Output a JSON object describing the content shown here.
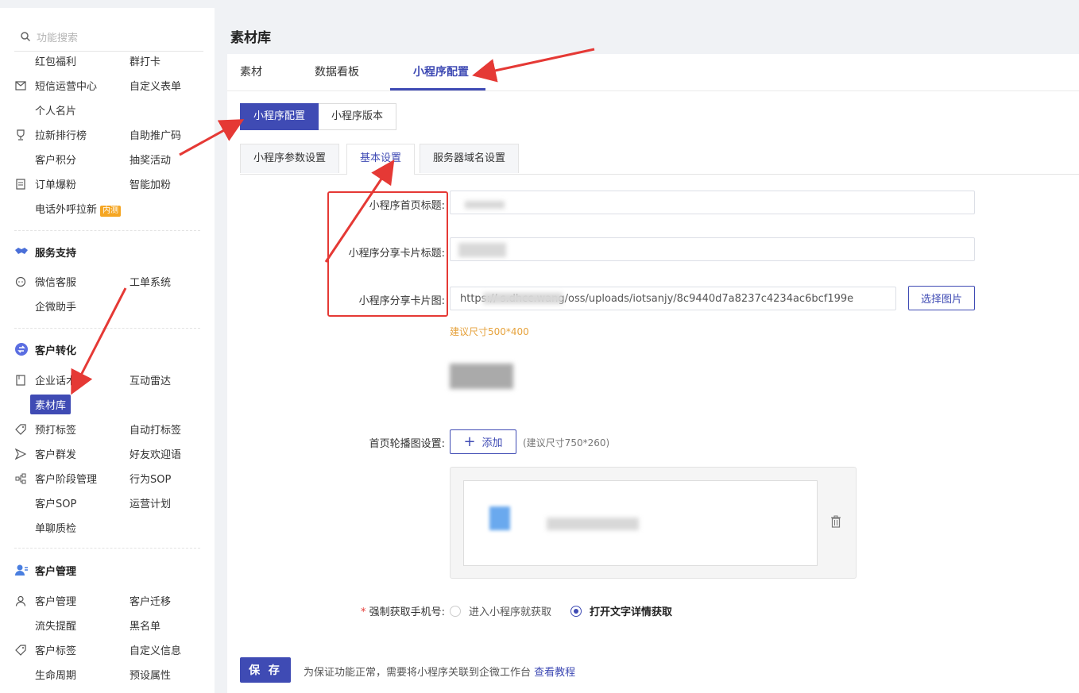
{
  "sidebar": {
    "search_placeholder": "功能搜索",
    "rows": [
      {
        "c1": "红包福利",
        "c2": "群打卡",
        "icon": ""
      },
      {
        "c1": "短信运营中心",
        "c2": "自定义表单",
        "icon": "mail-icon"
      },
      {
        "c1": "个人名片",
        "c2": "",
        "icon": ""
      },
      {
        "c1": "拉新排行榜",
        "c2": "自助推广码",
        "icon": "trophy-icon"
      },
      {
        "c1": "客户积分",
        "c2": "抽奖活动",
        "icon": ""
      },
      {
        "c1": "订单爆粉",
        "c2": "智能加粉",
        "icon": "order-icon"
      },
      {
        "c1": "电话外呼拉新",
        "c2": "",
        "icon": "",
        "badge": "内测"
      }
    ],
    "section_service": {
      "title": "服务支持",
      "rows": [
        {
          "c1": "微信客服",
          "c2": "工单系统",
          "icon": "chat-icon"
        },
        {
          "c1": "企微助手",
          "c2": "",
          "icon": ""
        }
      ]
    },
    "section_convert": {
      "title": "客户转化",
      "rows": [
        {
          "c1": "企业话术库",
          "c2": "互动雷达",
          "icon": "book-icon"
        },
        {
          "c1": "素材库",
          "c2": "",
          "icon": ""
        },
        {
          "c1": "预打标签",
          "c2": "自动打标签",
          "icon": "tag-icon"
        },
        {
          "c1": "客户群发",
          "c2": "好友欢迎语",
          "icon": "send-icon"
        },
        {
          "c1": "客户阶段管理",
          "c2": "行为SOP",
          "icon": "flow-icon"
        },
        {
          "c1": "客户SOP",
          "c2": "运营计划",
          "icon": ""
        },
        {
          "c1": "单聊质检",
          "c2": "",
          "icon": ""
        }
      ]
    },
    "section_manage": {
      "title": "客户管理",
      "rows": [
        {
          "c1": "客户管理",
          "c2": "客户迁移",
          "icon": "user-icon"
        },
        {
          "c1": "流失提醒",
          "c2": "黑名单",
          "icon": ""
        },
        {
          "c1": "客户标签",
          "c2": "自定义信息",
          "icon": "tag-icon"
        },
        {
          "c1": "生命周期",
          "c2": "预设属性",
          "icon": ""
        }
      ]
    }
  },
  "page": {
    "title": "素材库",
    "tabs": [
      "素材",
      "数据看板",
      "小程序配置"
    ],
    "segments": [
      "小程序配置",
      "小程序版本"
    ],
    "subtabs": [
      "小程序参数设置",
      "基本设置",
      "服务器域名设置"
    ]
  },
  "form": {
    "home_title_label": "小程序首页标题:",
    "share_title_label": "小程序分享卡片标题:",
    "share_image_label": "小程序分享卡片图:",
    "share_image_url": "https://                  s.dhcc.wang/oss/uploads/iotsanjy/8c9440d7a8237c4234ac6bcf199e",
    "choose_image_btn": "选择图片",
    "image_hint": "建议尺寸500*400",
    "carousel_label": "首页轮播图设置:",
    "add_btn": "添加",
    "carousel_hint": "(建议尺寸750*260)",
    "phone_label": "强制获取手机号:",
    "required_mark": "*",
    "radio_options": [
      "进入小程序就获取",
      "打开文字详情获取"
    ],
    "radio_selected": 1,
    "save_btn": "保 存",
    "note_text": "为保证功能正常，需要将小程序关联到企微工作台",
    "note_link": "查看教程"
  },
  "colors": {
    "accent": "#3f4bb4",
    "annotation": "#e53935",
    "hint": "#e6a23c"
  }
}
